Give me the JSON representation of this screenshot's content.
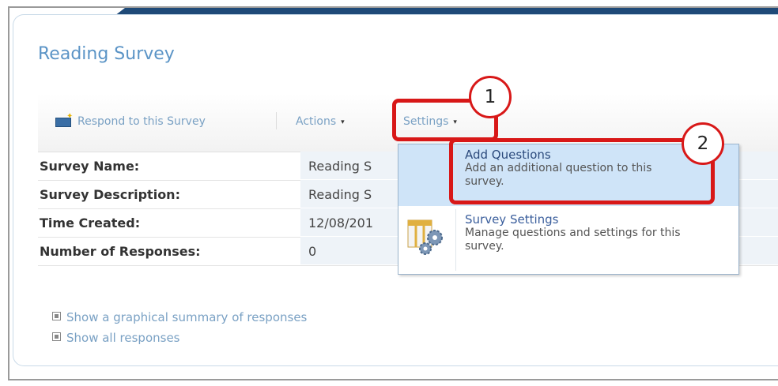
{
  "page": {
    "title": "Reading Survey"
  },
  "toolbar": {
    "respond_label": "Respond to this Survey",
    "actions_label": "Actions",
    "settings_label": "Settings",
    "caret": "▾"
  },
  "properties": [
    {
      "label": "Survey Name:",
      "value": "Reading S"
    },
    {
      "label": "Survey Description:",
      "value": "Reading S"
    },
    {
      "label": "Time Created:",
      "value": "12/08/201"
    },
    {
      "label": "Number of Responses:",
      "value": "0"
    }
  ],
  "links": [
    {
      "label": "Show a graphical summary of responses"
    },
    {
      "label": "Show all responses"
    }
  ],
  "settings_menu": {
    "items": [
      {
        "title": "Add Questions",
        "description": "Add an additional question to this survey."
      },
      {
        "title": "Survey Settings",
        "description": "Manage questions and settings for this survey."
      }
    ]
  },
  "annotations": {
    "step1": "1",
    "step2": "2",
    "color": "#d81818"
  }
}
